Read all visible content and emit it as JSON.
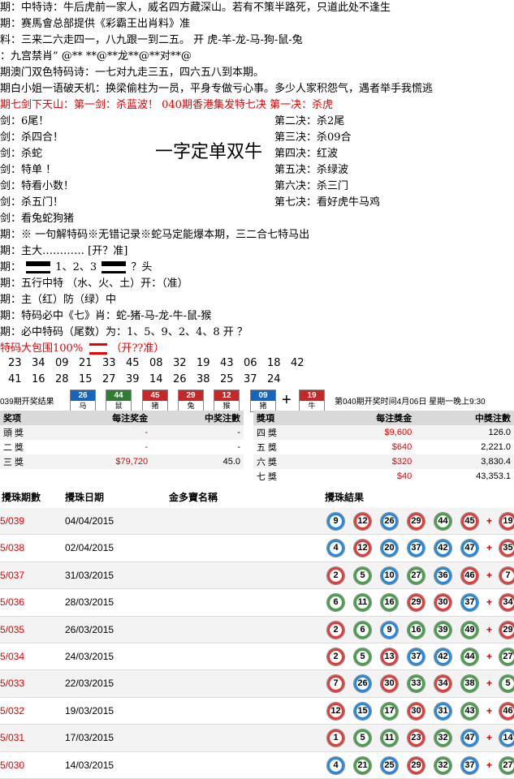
{
  "lines": [
    "期：中特诗：牛后虎前一家人，威名四方藏深山。若有不策半路死，只道此处不逢生",
    "期：赛馬會总部提供《彩霸王出肖料》准",
    "料：三来二六走四一，八九跟一到二五。        开   虎-羊-龙-马-狗-鼠-兔",
    "：九宫禁肖”   @** **@**龙**@**对**@",
    "期澳门双色特码诗：一七对九走三五，四六五八到本期。",
    "期白小姐一语破天机：换梁偷柱为一员，平身专做亏心事。多少人家积怨气，遇者举手我慌逃",
    "期七剑下天山：第一剑：杀蓝波！         040期香港集发特七决  第一决：杀虎",
    "剑：6尾！",
    "剑：杀四合！",
    "剑：杀蛇",
    "剑：特单 ！",
    "剑：特看小数！",
    "剑：杀五门！",
    "剑：看兔蛇狗猪",
    "期：※ 一句解特码※无错记录※蛇马定能爆本期，三二合七特马出",
    "期：主大………… [开？准]",
    "期：",
    "期：五行中特   （水、火、土）开：（准）",
    "期：主（红）防（绿）中",
    "期：特码必中《七》肖：蛇-猪-马-龙-牛-鼠-猴",
    "期：必中特码（尾数）为：1、5、9、2、4、8       开 ？",
    "特码大包围100%"
  ],
  "line16_mid": "1、2、3",
  "line16_tail": "？头",
  "line22_tail": "（开??准）",
  "right_col": [
    "第二决：杀2尾",
    "第三决：杀09合",
    "第四决：红波",
    "第五决：杀绿波",
    "第六决：杀三门",
    "第七决：看好虎牛马鸡"
  ],
  "big_text": "一字定单双牛",
  "nums_row1": [
    "23",
    "34",
    "09",
    "21",
    "33",
    "45",
    "08",
    "32",
    "19",
    "43",
    "06",
    "18",
    "42"
  ],
  "nums_row2": [
    "41",
    "16",
    "28",
    "15",
    "27",
    "39",
    "14",
    "26",
    "38",
    "25",
    "37",
    "24"
  ],
  "draw": {
    "label": "039期开奖结果",
    "plus": "+",
    "tiles": [
      {
        "n": "26",
        "z": "马",
        "c": "#1565c0"
      },
      {
        "n": "44",
        "z": "鼠",
        "c": "#2e7d32"
      },
      {
        "n": "45",
        "z": "猪",
        "c": "#c62828"
      },
      {
        "n": "29",
        "z": "兔",
        "c": "#c62828"
      },
      {
        "n": "12",
        "z": "猴",
        "c": "#c62828"
      },
      {
        "n": "09",
        "z": "猪",
        "c": "#1565c0"
      },
      {
        "n": "19",
        "z": "牛",
        "c": "#c62828"
      }
    ],
    "next_info": "第040期开奖时间4月06日  星期一晚上9:30"
  },
  "prize_left": {
    "headers": [
      "奖项",
      "每注奖金",
      "中奖注數"
    ],
    "rows": [
      [
        "頭 獎",
        "-",
        "-"
      ],
      [
        "二 獎",
        "-",
        "-"
      ],
      [
        "三 獎",
        "$79,720",
        "45.0"
      ]
    ]
  },
  "prize_right": {
    "headers": [
      "獎項",
      "每注獎金",
      "中獎注數"
    ],
    "rows": [
      [
        "四 獎",
        "$9,600",
        "126.0"
      ],
      [
        "五 獎",
        "$640",
        "2,221.0"
      ],
      [
        "六 獎",
        "$320",
        "3,830.4"
      ],
      [
        "七 獎",
        "$40",
        "43,353.1"
      ]
    ]
  },
  "history": {
    "headers": [
      "攪珠期數",
      "攪珠日期",
      "金多寶名稱",
      "攪珠結果"
    ],
    "rows": [
      {
        "period": "5/039",
        "date": "04/04/2015",
        "balls": [
          "9",
          "12",
          "26",
          "29",
          "44",
          "45"
        ],
        "extra": "19",
        "colors": [
          "b",
          "r",
          "b",
          "r",
          "g",
          "r",
          "r"
        ]
      },
      {
        "period": "5/038",
        "date": "02/04/2015",
        "balls": [
          "4",
          "12",
          "20",
          "37",
          "42",
          "47"
        ],
        "extra": "35",
        "colors": [
          "b",
          "r",
          "b",
          "b",
          "b",
          "b",
          "r"
        ]
      },
      {
        "period": "5/037",
        "date": "31/03/2015",
        "balls": [
          "2",
          "5",
          "10",
          "27",
          "36",
          "46"
        ],
        "extra": "7",
        "colors": [
          "r",
          "g",
          "b",
          "g",
          "b",
          "r",
          "r"
        ]
      },
      {
        "period": "5/036",
        "date": "28/03/2015",
        "balls": [
          "6",
          "11",
          "16",
          "29",
          "30",
          "37"
        ],
        "extra": "34",
        "colors": [
          "g",
          "g",
          "g",
          "r",
          "r",
          "b"
        ],
        "x": "r"
      },
      {
        "period": "5/035",
        "date": "26/03/2015",
        "balls": [
          "2",
          "6",
          "9",
          "16",
          "39",
          "49"
        ],
        "extra": "29",
        "colors": [
          "r",
          "g",
          "b",
          "g",
          "g",
          "g",
          "r"
        ]
      },
      {
        "period": "5/034",
        "date": "24/03/2015",
        "balls": [
          "2",
          "5",
          "13",
          "37",
          "42",
          "44"
        ],
        "extra": "27",
        "colors": [
          "r",
          "g",
          "r",
          "b",
          "b",
          "g",
          "g"
        ]
      },
      {
        "period": "5/033",
        "date": "22/03/2015",
        "balls": [
          "7",
          "26",
          "30",
          "33",
          "34",
          "38"
        ],
        "extra": "5",
        "colors": [
          "r",
          "b",
          "r",
          "g",
          "r",
          "g",
          "g"
        ]
      },
      {
        "period": "5/032",
        "date": "19/03/2015",
        "balls": [
          "12",
          "15",
          "17",
          "30",
          "31",
          "43"
        ],
        "extra": "46",
        "colors": [
          "r",
          "b",
          "g",
          "r",
          "b",
          "g",
          "r"
        ]
      },
      {
        "period": "5/031",
        "date": "17/03/2015",
        "balls": [
          "1",
          "5",
          "11",
          "23",
          "32",
          "47"
        ],
        "extra": "14",
        "colors": [
          "r",
          "g",
          "g",
          "r",
          "g",
          "b",
          "b"
        ]
      },
      {
        "period": "5/030",
        "date": "14/03/2015",
        "balls": [
          "4",
          "21",
          "25",
          "29",
          "32",
          "37"
        ],
        "extra": "27",
        "colors": [
          "b",
          "g",
          "b",
          "r",
          "g",
          "b",
          "g"
        ]
      }
    ]
  }
}
